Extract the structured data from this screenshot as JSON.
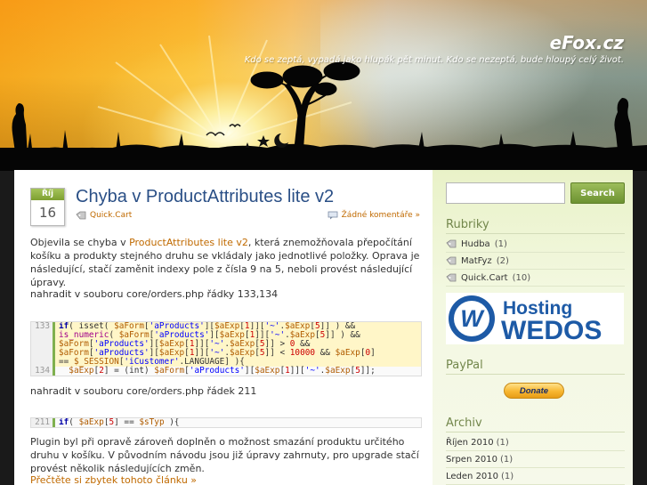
{
  "header": {
    "site_title": "eFox.cz",
    "tagline": "Kdo se zeptá, vypadá jako hlupák pět minut. Kdo se nezeptá, bude hloupý celý život."
  },
  "post": {
    "date_month": "Říj",
    "date_day": "16",
    "title": "Chyba v ProductAttributes lite v2",
    "category": "Quick.Cart",
    "comments": "Žádné komentáře »",
    "intro_before": "Objevila se chyba v ",
    "intro_link": "ProductAttributes lite v2",
    "intro_after": ", která znemožňovala přepočítání košíku a produkty stejného druhu se vkládaly jako jednotlivé položky. Oprava je následující, stačí zaměnit indexy pole z čísla 9 na 5, neboli provést následující úpravy.",
    "replace_1": "nahradit v souboru core/orders.php řádky 133,134",
    "code_1_line_a": "133",
    "code_1_line_b": "134",
    "replace_2": "nahradit v souboru core/orders.php řádek 211",
    "code_2_line": "211",
    "outro": "Plugin byl při opravě zároveň doplněn o možnost smazání produktu určitého druhu v košíku. V původním návodu jsou již úpravy zahrnuty, pro upgrade stačí provést několik následujících změn.",
    "read_more": "Přečtěte si zbytek tohoto článku »"
  },
  "sidebar": {
    "search_placeholder": "",
    "search_button": "Search",
    "rubriky_title": "Rubriky",
    "categories": [
      {
        "label": "Hudba",
        "count": "(1)"
      },
      {
        "label": "MatFyz",
        "count": "(2)"
      },
      {
        "label": "Quick.Cart",
        "count": "(10)"
      }
    ],
    "banner_word_1": "Hosting",
    "banner_word_2": "WEDOS",
    "paypal_title": "PayPal",
    "donate_label": "Donate",
    "archive_title": "Archiv",
    "archives": [
      {
        "label": "Říjen 2010",
        "count": "(1)"
      },
      {
        "label": "Srpen 2010",
        "count": "(1)"
      },
      {
        "label": "Leden 2010",
        "count": "(1)"
      }
    ]
  },
  "colors": {
    "accent_green": "#7d9f30",
    "link_orange": "#c06a00",
    "title_blue": "#2a4f86",
    "wedos_blue": "#1d5aa6"
  }
}
